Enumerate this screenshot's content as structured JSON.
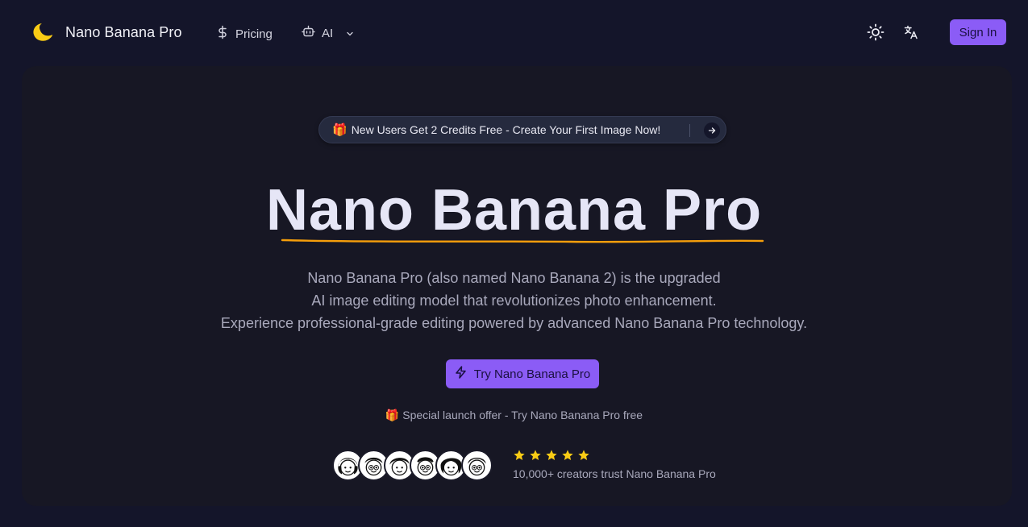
{
  "header": {
    "brand": "Nano Banana Pro",
    "logo_icon": "moon-icon",
    "nav": {
      "pricing": {
        "label": "Pricing",
        "icon": "dollar-icon"
      },
      "ai": {
        "label": "AI",
        "icon": "robot-icon",
        "dropdown_icon": "chevron-down-icon"
      }
    },
    "theme_icon": "sun-icon",
    "language_icon": "translate-icon",
    "sign_in": "Sign In"
  },
  "hero": {
    "promo": {
      "emoji": "🎁",
      "text": "New Users Get 2 Credits Free - Create Your First Image Now!",
      "icon": "arrow-right-icon"
    },
    "title": "Nano Banana Pro",
    "description": [
      "Nano Banana Pro (also named Nano Banana 2) is the upgraded",
      "AI image editing model that revolutionizes photo enhancement.",
      "Experience professional-grade editing powered by advanced Nano Banana Pro technology."
    ],
    "cta": {
      "label": "Try Nano Banana Pro",
      "icon": "lightning-icon"
    },
    "offer": {
      "emoji": "🎁",
      "text": "Special launch offer - Try Nano Banana Pro free"
    },
    "social_proof": {
      "avatar_count": 6,
      "rating_stars": 5,
      "text": "10,000+ creators trust Nano Banana Pro"
    }
  },
  "colors": {
    "background": "#14152a",
    "card": "#171724",
    "accent": "#8b5cf6",
    "underline": "#f59e0b",
    "star": "#facc15"
  }
}
